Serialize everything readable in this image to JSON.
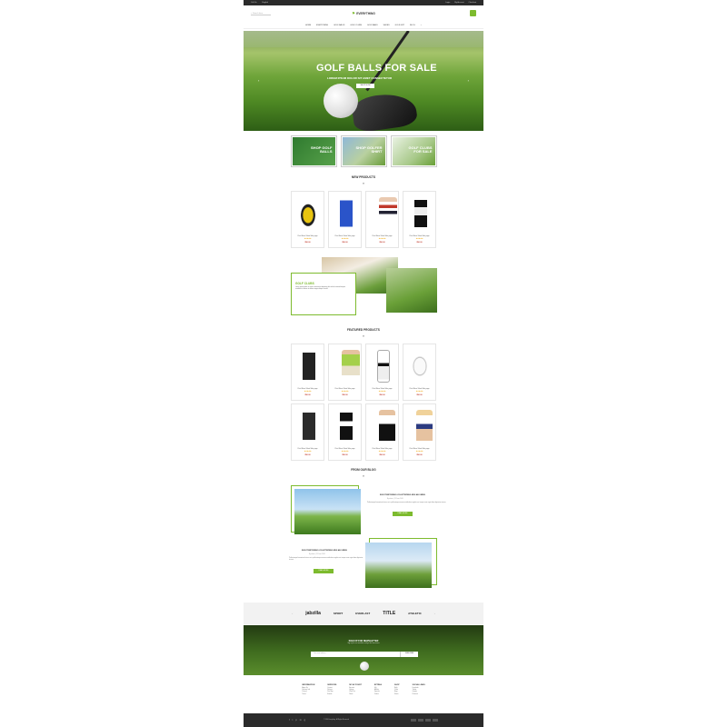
{
  "topbar": {
    "left": [
      "Call Us",
      "English"
    ],
    "right": [
      "Login",
      "My Account",
      "Checkout"
    ]
  },
  "header": {
    "search_placeholder": "Search here",
    "logo": "EVERYTHING"
  },
  "nav": [
    "HOME",
    "EVERYTHING",
    "GOLF BALLS",
    "GOLF CLUBS",
    "GOLF BAGS",
    "SHOES",
    "GOLF GIFT",
    "BLOG"
  ],
  "hero": {
    "title": "GOLF BALLS FOR SALE",
    "subtitle": "LOREM IPSUM DOLOR SIT AMET CONSECTETUR",
    "button": "SHOP NOW"
  },
  "banners": [
    {
      "label": "SHOP GOLF BALLS"
    },
    {
      "label": "SHOP GOLFER SHIRT"
    },
    {
      "label": "GOLF CLUBS FOR SALE"
    }
  ],
  "new_products": {
    "title": "NEW PRODUCTS",
    "items": [
      {
        "name": "Print Mens Short Sale yoga",
        "price": "$90.00"
      },
      {
        "name": "Print Mens Short Sale yoga",
        "price": "$90.00"
      },
      {
        "name": "Print Mens Short Sale yoga",
        "price": "$90.00"
      },
      {
        "name": "Print Mens Short Sale yoga",
        "price": "$90.00"
      }
    ]
  },
  "feature": {
    "title": "GOLF CLUBS",
    "text": "Lorem ipsum dolor sit amet consectetur adipiscing elit sed do eiusmod tempor incididunt ut labore et dolore magna aliqua ut enim"
  },
  "featured_products": {
    "title": "FEATURED PRODUCTS",
    "items": [
      {
        "name": "Print Mens Short Sale yoga",
        "price": "$90.00"
      },
      {
        "name": "Print Mens Short Sale yoga",
        "price": "$90.00"
      },
      {
        "name": "Print Mens Short Sale yoga",
        "price": "$90.00"
      },
      {
        "name": "Print Mens Short Sale yoga",
        "price": "$90.00"
      },
      {
        "name": "Print Mens Short Sale yoga",
        "price": "$90.00"
      },
      {
        "name": "Print Mens Short Sale yoga",
        "price": "$90.00"
      },
      {
        "name": "Print Mens Short Sale yoga",
        "price": "$90.00"
      },
      {
        "name": "Print Mens Short Sale yoga",
        "price": "$90.00"
      }
    ]
  },
  "blog": {
    "title": "FROM OUR BLOG",
    "posts": [
      {
        "title": "EIUS TEMPORIBUS VOLUPTATIBUS MUS AB OMNIS",
        "meta": "By admin  |  25 June 2016",
        "text": "Pellentesque fermentum luctus orci a pellentesque massa vestibulum sagittis nec tempor enim eget diam dignissim viverra.",
        "button": "READ MORE"
      },
      {
        "title": "EIUS TEMPORIBUS VOLUPTATIBUS MUS AB OMNIS",
        "meta": "By admin  |  25 June 2016",
        "text": "Pellentesque fermentum luctus orci a pellentesque massa vestibulum sagittis nec tempor enim eget diam dignissim viverra.",
        "button": "READ MORE"
      }
    ]
  },
  "brands": [
    "jabzilla",
    "SPORT",
    "EVERLAST",
    "TITLE",
    "ATHLETIC"
  ],
  "newsletter": {
    "title": "SIGN UP FOR NEWSLETTER",
    "subtitle": "Sign up for our newsletter and get the latest news",
    "placeholder": "Your email address",
    "button": "SUBSCRIBE"
  },
  "footer": [
    {
      "heading": "INFORMATION",
      "links": [
        "About Us",
        "Delivery Info",
        "Privacy",
        "Terms"
      ]
    },
    {
      "heading": "SERVICES",
      "links": [
        "Contact",
        "Returns",
        "Site Map",
        "Brands"
      ]
    },
    {
      "heading": "MY ACCOUNT",
      "links": [
        "Account",
        "History",
        "Wish List",
        "News"
      ]
    },
    {
      "heading": "EXTRAS",
      "links": [
        "Gift",
        "Affiliate",
        "Specials",
        "Orders"
      ]
    },
    {
      "heading": "SHOP",
      "links": [
        "Balls",
        "Clubs",
        "Bags",
        "Shoes"
      ]
    },
    {
      "heading": "SOCIAL LINKS",
      "links": [
        "Facebook",
        "Twitter",
        "Google",
        "Pinterest"
      ]
    }
  ],
  "copyright": "© 2016 Everything. All Rights Reserved",
  "accent_color": "#7dbb2e"
}
